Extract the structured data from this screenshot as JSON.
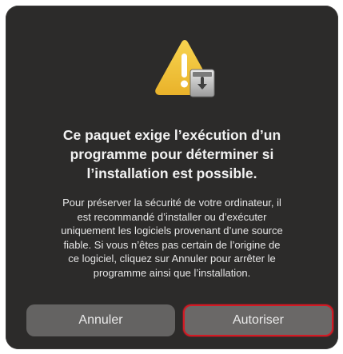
{
  "dialog": {
    "title_lines": [
      "Ce paquet exige l’exécution d’un",
      "programme pour déterminer si",
      "l’installation est possible."
    ],
    "message_lines": [
      "Pour préserver la sécurité de votre ordinateur, il",
      "est recommandé d’installer ou d’exécuter",
      "uniquement les logiciels provenant d’une source",
      "fiable. Si vous n’êtes pas certain de l’origine de",
      "ce logiciel, cliquez sur Annuler pour arrêter le",
      "programme ainsi que l’installation."
    ],
    "icon": "warning-installer-icon",
    "buttons": {
      "cancel_label": "Annuler",
      "allow_label": "Autoriser"
    }
  },
  "colors": {
    "panel_bg": "#2c2b2a",
    "button_bg": "#646362",
    "focus_ring": "#d21a24",
    "warning_yellow": "#f4c542"
  }
}
